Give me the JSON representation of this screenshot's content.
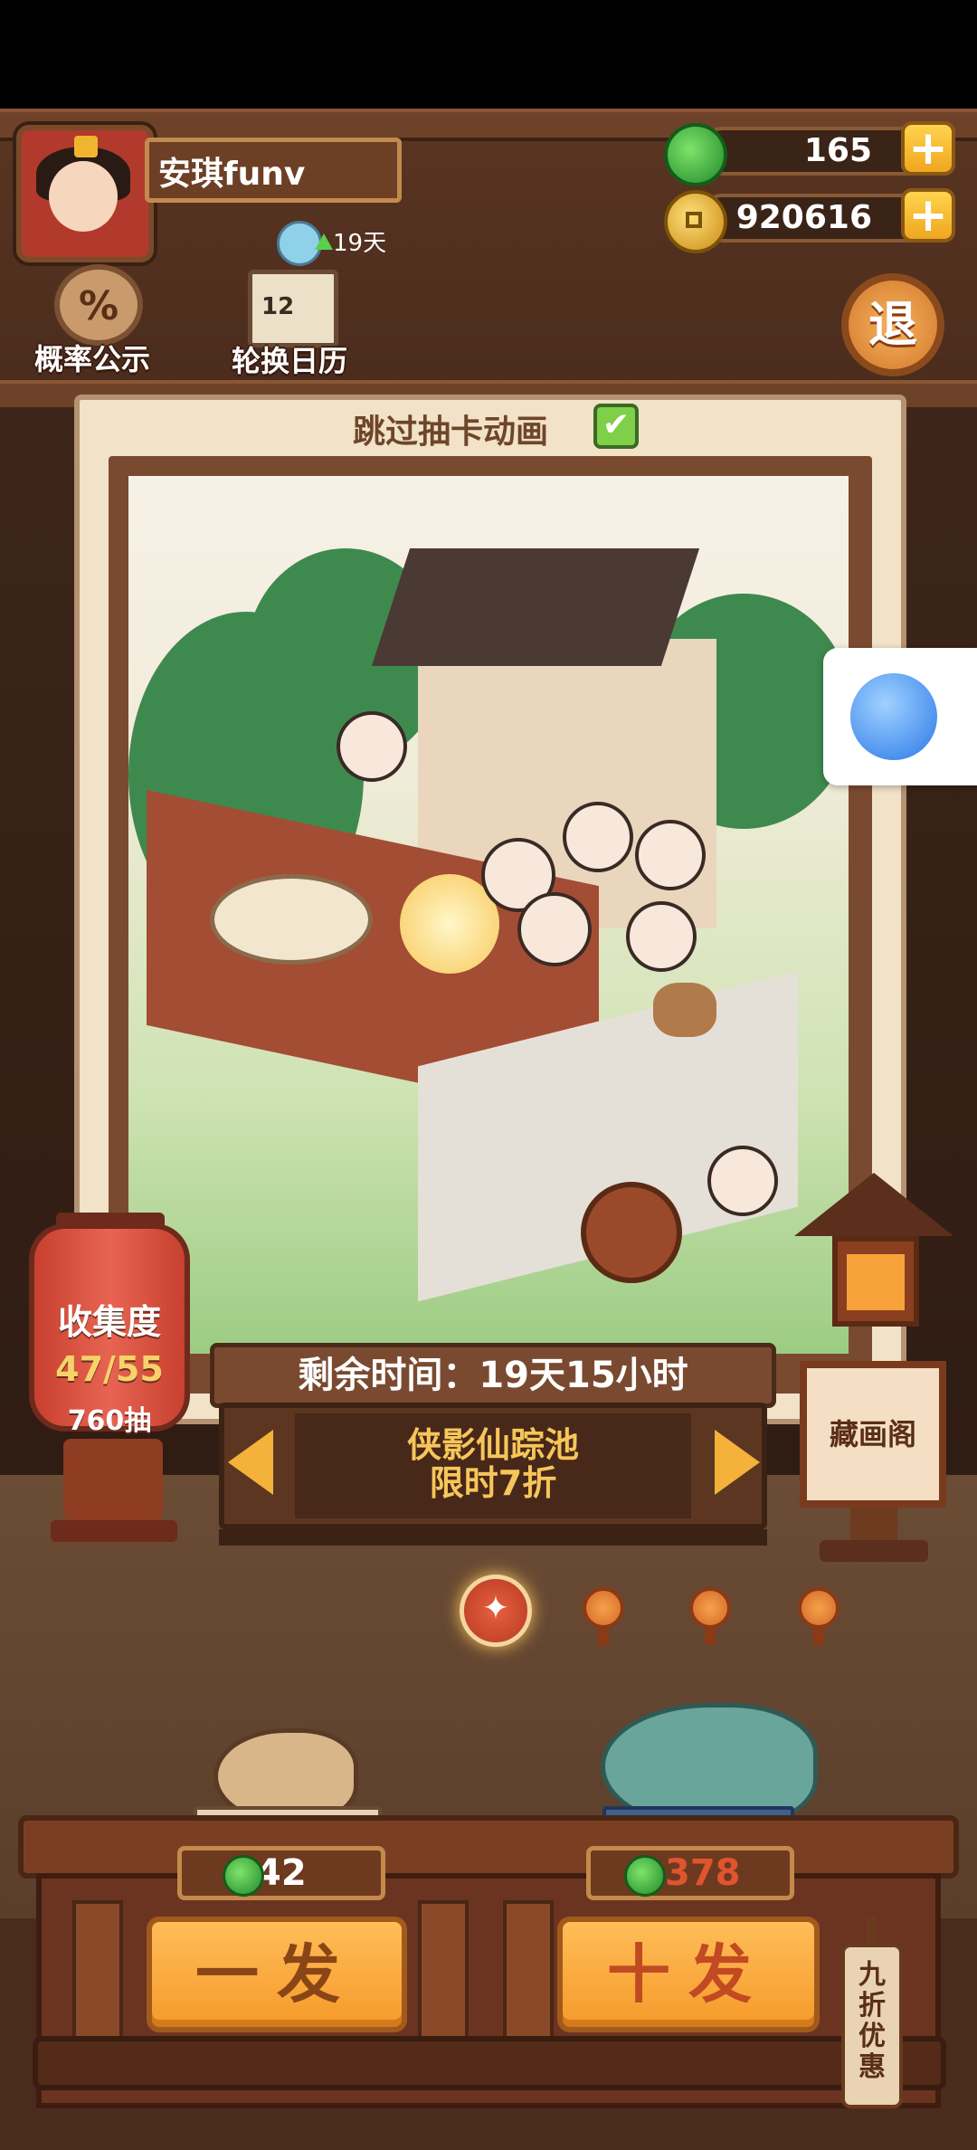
{
  "player": {
    "name": "安琪funv",
    "days": "19天"
  },
  "currency": {
    "gems": "165",
    "coins": "920616",
    "plus": "+"
  },
  "top_icons": {
    "probability_label": "概率公示",
    "probability_symbol": "%",
    "calendar_label": "轮换日历",
    "calendar_number": "12",
    "exit_label": "退"
  },
  "card": {
    "skip_label": "跳过抽卡动画",
    "skip_checked": true,
    "check_mark": "✔"
  },
  "collection": {
    "title": "收集度",
    "progress": "47/55",
    "pulls": "760抽"
  },
  "banner": {
    "remaining": "剩余时间：19天15小时",
    "pool_line1": "侠影仙踪池",
    "pool_line2": "限时7折"
  },
  "gallery": {
    "label": "藏画阁"
  },
  "pagination": {
    "total": 4,
    "active_index": 0
  },
  "draw": {
    "single_label": "一发",
    "single_cost": "42",
    "ten_label": "十发",
    "ten_cost": "378",
    "discount_tag": "九折优惠"
  },
  "colors": {
    "gem_green": "#2ea43a",
    "coin_gold": "#f0b52f",
    "accent_orange": "#f59a2a",
    "ten_cost_red": "#e0552e"
  }
}
